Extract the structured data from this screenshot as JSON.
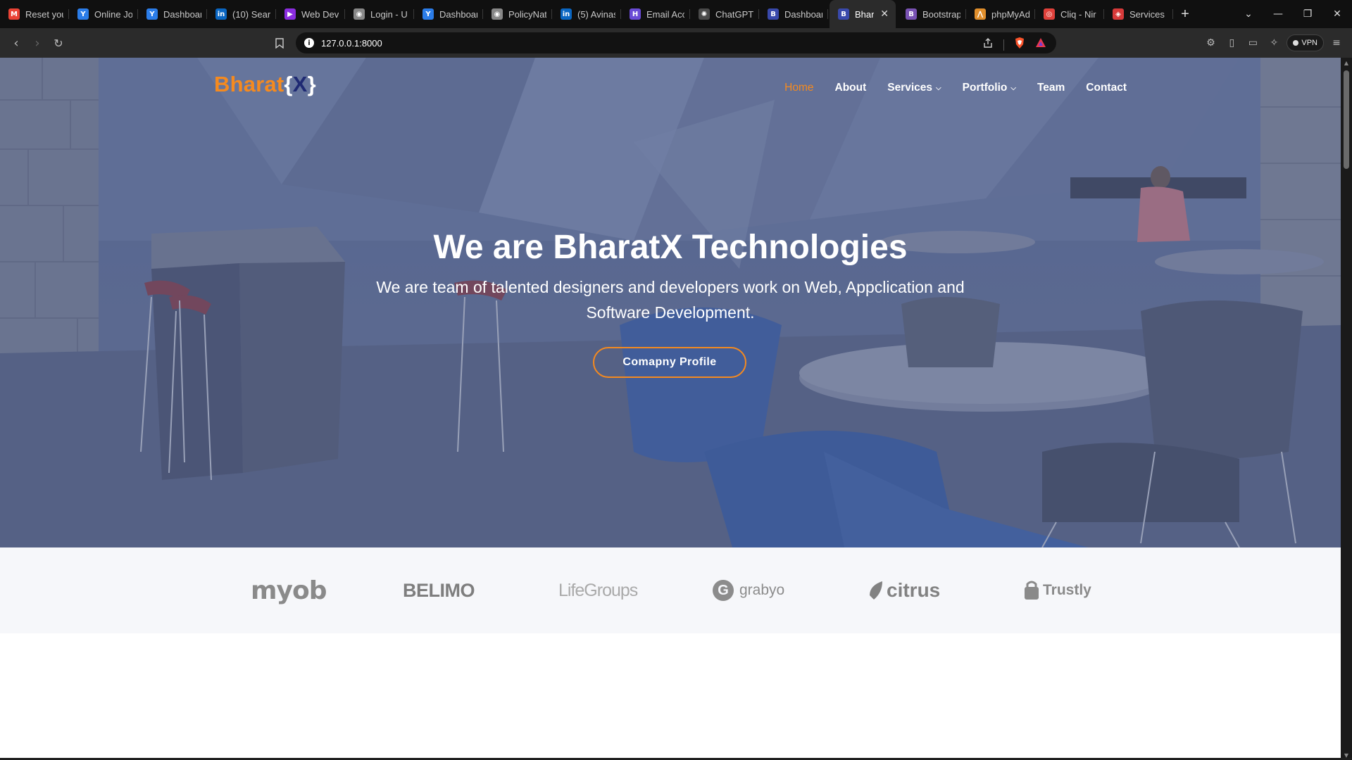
{
  "browser": {
    "tabs": [
      {
        "label": "Reset you",
        "icon": "gmail-icon",
        "color": "#ea4335",
        "glyph": "M"
      },
      {
        "label": "Online Jo",
        "icon": "y-logo-icon",
        "color": "#2b7de9",
        "glyph": "Y"
      },
      {
        "label": "Dashboar",
        "icon": "y-logo-icon",
        "color": "#2b7de9",
        "glyph": "Y"
      },
      {
        "label": "(10) Sear",
        "icon": "linkedin-icon",
        "color": "#0a66c2",
        "glyph": "in"
      },
      {
        "label": "Web Dev",
        "icon": "play-arrow-icon",
        "color": "#8b2de0",
        "glyph": "▶"
      },
      {
        "label": "Login - U",
        "icon": "globe-icon",
        "color": "#888888",
        "glyph": "◉"
      },
      {
        "label": "Dashboar",
        "icon": "y-logo-icon",
        "color": "#2b7de9",
        "glyph": "Y"
      },
      {
        "label": "PolicyNat",
        "icon": "globe-icon",
        "color": "#888888",
        "glyph": "◉"
      },
      {
        "label": "(5) Avinas",
        "icon": "linkedin-icon",
        "color": "#0a66c2",
        "glyph": "in"
      },
      {
        "label": "Email Acc",
        "icon": "h-logo-icon",
        "color": "#6a4bd6",
        "glyph": "H"
      },
      {
        "label": "ChatGPT",
        "icon": "chatgpt-icon",
        "color": "#4a4a4a",
        "glyph": "✺"
      },
      {
        "label": "Dashboar",
        "icon": "b-logo-icon",
        "color": "#3949ab",
        "glyph": "B"
      },
      {
        "label": "Bhar",
        "icon": "b-logo-icon",
        "color": "#3949ab",
        "glyph": "B",
        "active": true
      },
      {
        "label": "Bootstrap",
        "icon": "bootstrap-icon",
        "color": "#7952b3",
        "glyph": "B"
      },
      {
        "label": "phpMyAd",
        "icon": "phpmyadmin-icon",
        "color": "#e08e2b",
        "glyph": "⋀"
      },
      {
        "label": "Cliq - Nir",
        "icon": "cliq-icon",
        "color": "#e0413b",
        "glyph": "◎"
      },
      {
        "label": "Services",
        "icon": "services-icon",
        "color": "#d73a3a",
        "glyph": "◈"
      }
    ],
    "new_tab": "+",
    "close_tab": "✕",
    "url": "127.0.0.1:8000",
    "vpn_label": "VPN"
  },
  "site": {
    "brand": {
      "part1": "Bharat",
      "open": "{",
      "x": "X",
      "close": "}"
    },
    "nav": [
      {
        "label": "Home",
        "active": true
      },
      {
        "label": "About"
      },
      {
        "label": "Services",
        "dropdown": true
      },
      {
        "label": "Portfolio",
        "dropdown": true
      },
      {
        "label": "Team"
      },
      {
        "label": "Contact"
      }
    ],
    "hero": {
      "title": "We are BharatX Technologies",
      "subtitle": "We are team of talented designers and developers work on Web, Appclication and Software Development.",
      "cta": "Comapny Profile"
    },
    "clients": [
      "myob",
      "BELIMO",
      "LifeGroups",
      "grabyo",
      "citrus",
      "Trustly"
    ]
  },
  "colors": {
    "accent": "#f58a1f",
    "brand_x": "#1f2a73",
    "hero_overlay": "#5d6b8d"
  }
}
